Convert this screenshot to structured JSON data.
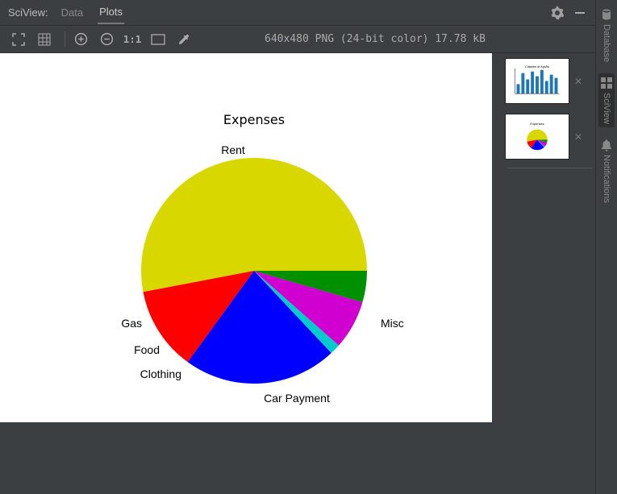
{
  "header": {
    "title": "SciView:",
    "tabs": [
      "Data",
      "Plots"
    ],
    "active_tab": "Plots"
  },
  "toolbar": {
    "ratio": "1:1",
    "status": "640x480 PNG (24-bit color) 17.78 kB"
  },
  "thumbnails": [
    {
      "kind": "bar"
    },
    {
      "kind": "pie"
    }
  ],
  "right_rail": [
    {
      "label": "Database",
      "active": false
    },
    {
      "label": "SciView",
      "active": true
    },
    {
      "label": "Notifications",
      "active": false
    }
  ],
  "chart_data": {
    "type": "pie",
    "title": "Expenses",
    "categories": [
      "Rent",
      "Misc",
      "Car Payment",
      "Clothing",
      "Food",
      "Gas"
    ],
    "values": [
      53,
      12,
      22,
      1.5,
      7,
      4.5
    ],
    "colors": [
      "#d8d800",
      "#ff0000",
      "#0000ff",
      "#00cccc",
      "#d000d0",
      "#009000"
    ]
  }
}
